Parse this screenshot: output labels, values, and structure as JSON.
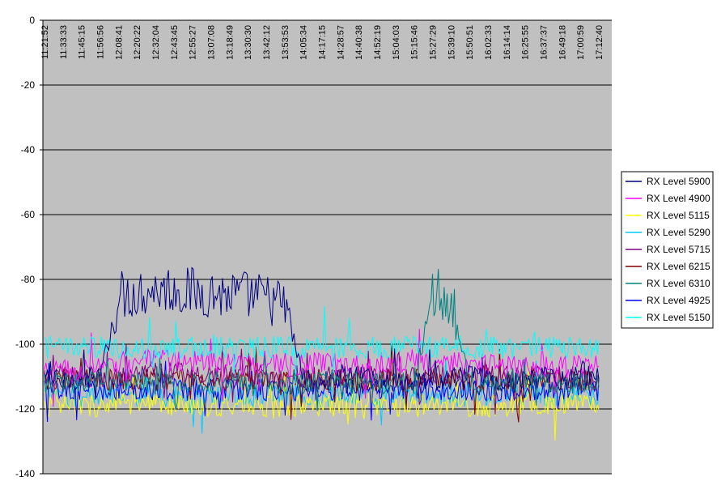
{
  "chart_data": {
    "type": "line",
    "title": "",
    "xlabel": "",
    "ylabel": "",
    "ylim": [
      -140,
      0
    ],
    "yticks": [
      0,
      -20,
      -40,
      -60,
      -80,
      -100,
      -120,
      -140
    ],
    "grid": true,
    "legend_position": "right",
    "x": [
      "11:21:52",
      "11:33:33",
      "11:45:15",
      "11:56:56",
      "12:08:41",
      "12:20:22",
      "12:32:04",
      "12:43:45",
      "12:55:27",
      "13:07:08",
      "13:18:49",
      "13:30:30",
      "13:42:12",
      "13:53:53",
      "14:05:34",
      "14:17:15",
      "14:28:57",
      "14:40:38",
      "14:52:19",
      "15:04:03",
      "15:15:46",
      "15:27:29",
      "15:39:10",
      "15:50:51",
      "16:02:33",
      "16:14:14",
      "16:25:55",
      "16:37:37",
      "16:49:18",
      "17:00:59",
      "17:12:40"
    ],
    "series": [
      {
        "name": "RX Level 5900",
        "color": "#000080",
        "values": [
          -110,
          -112,
          -110,
          -111,
          -85,
          -84,
          -83,
          -83,
          -84,
          -84,
          -85,
          -85,
          -86,
          -88,
          -111,
          -112,
          -111,
          -110,
          -112,
          -111,
          -112,
          -112,
          -111,
          -110,
          -111,
          -112,
          -111,
          -110,
          -111,
          -110,
          -110
        ]
      },
      {
        "name": "RX Level 4900",
        "color": "#ff00ff",
        "values": [
          -109,
          -108,
          -108,
          -107,
          -106,
          -105,
          -105,
          -105,
          -105,
          -106,
          -106,
          -106,
          -106,
          -106,
          -106,
          -106,
          -106,
          -106,
          -106,
          -105,
          -106,
          -106,
          -106,
          -106,
          -106,
          -107,
          -107,
          -107,
          -107,
          -107,
          -107
        ]
      },
      {
        "name": "RX Level 5115",
        "color": "#ffff00",
        "values": [
          -119,
          -119,
          -119,
          -119,
          -118,
          -119,
          -119,
          -119,
          -119,
          -119,
          -119,
          -119,
          -119,
          -119,
          -119,
          -119,
          -119,
          -120,
          -119,
          -119,
          -119,
          -119,
          -119,
          -119,
          -119,
          -119,
          -119,
          -119,
          -118,
          -118,
          -118
        ]
      },
      {
        "name": "RX Level 5290",
        "color": "#00ccff",
        "values": [
          -116,
          -116,
          -116,
          -116,
          -116,
          -116,
          -116,
          -116,
          -116,
          -116,
          -116,
          -116,
          -116,
          -116,
          -116,
          -116,
          -116,
          -116,
          -116,
          -116,
          -116,
          -116,
          -116,
          -116,
          -116,
          -116,
          -116,
          -116,
          -116,
          -116,
          -116
        ]
      },
      {
        "name": "RX Level 5715",
        "color": "#800080",
        "values": [
          -110,
          -110,
          -110,
          -110,
          -110,
          -109,
          -109,
          -109,
          -109,
          -109,
          -110,
          -110,
          -110,
          -110,
          -110,
          -110,
          -110,
          -110,
          -110,
          -110,
          -110,
          -110,
          -110,
          -110,
          -110,
          -110,
          -110,
          -110,
          -110,
          -110,
          -110
        ]
      },
      {
        "name": "RX Level 6215",
        "color": "#800000",
        "values": [
          -111,
          -111,
          -111,
          -111,
          -111,
          -111,
          -111,
          -111,
          -111,
          -111,
          -111,
          -111,
          -111,
          -111,
          -111,
          -111,
          -111,
          -111,
          -111,
          -111,
          -111,
          -111,
          -111,
          -111,
          -111,
          -111,
          -111,
          -111,
          -111,
          -111,
          -111
        ]
      },
      {
        "name": "RX Level 6310",
        "color": "#008080",
        "values": [
          -112,
          -112,
          -112,
          -112,
          -112,
          -112,
          -112,
          -112,
          -112,
          -112,
          -112,
          -112,
          -112,
          -112,
          -112,
          -112,
          -112,
          -112,
          -112,
          -112,
          -112,
          -84,
          -86,
          -112,
          -112,
          -112,
          -112,
          -112,
          -112,
          -112,
          -112
        ]
      },
      {
        "name": "RX Level 4925",
        "color": "#0000ff",
        "values": [
          -114,
          -114,
          -114,
          -114,
          -114,
          -114,
          -114,
          -114,
          -114,
          -114,
          -114,
          -114,
          -114,
          -114,
          -114,
          -114,
          -114,
          -114,
          -114,
          -114,
          -114,
          -114,
          -114,
          -114,
          -114,
          -114,
          -114,
          -114,
          -114,
          -114,
          -114
        ]
      },
      {
        "name": "RX Level 5150",
        "color": "#00ffff",
        "values": [
          -101,
          -101,
          -101,
          -101,
          -101,
          -101,
          -101,
          -101,
          -101,
          -101,
          -101,
          -101,
          -101,
          -101,
          -101,
          -101,
          -101,
          -101,
          -101,
          -101,
          -101,
          -101,
          -101,
          -101,
          -101,
          -101,
          -101,
          -101,
          -101,
          -101,
          -101
        ]
      }
    ]
  },
  "colors": {
    "plot_background": "#c0c0c0",
    "page_background": "#ffffff",
    "gridline": "#000000"
  }
}
